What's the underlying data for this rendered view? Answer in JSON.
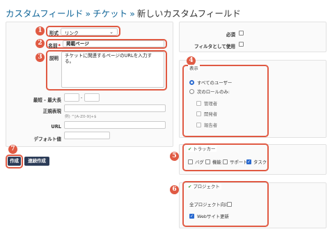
{
  "breadcrumb": {
    "custom_fields": "カスタムフィールド",
    "sep1": "»",
    "tickets": "チケット",
    "sep2": "»",
    "current": "新しいカスタムフィールド"
  },
  "badges": {
    "b1": "1",
    "b2": "2",
    "b3": "3",
    "b4": "4",
    "b5": "5",
    "b6": "6",
    "b7": "7"
  },
  "form": {
    "format_label": "形式",
    "format_value": "リンク",
    "name_label": "名前",
    "name_required": "*",
    "name_value": "掲載ページ",
    "desc_label": "説明",
    "desc_value": "チケットに関連するページのURLを入力する。",
    "minmax_label": "最短 - 最大長",
    "minmax_dash": "-",
    "regex_label": "正規表現",
    "regex_hint": "例) ^[A-Z0-9]+$",
    "url_label": "URL",
    "default_label": "デフォルト値"
  },
  "side": {
    "required_label": "必須",
    "filter_label": "フィルタとして使用",
    "visible_legend": "表示",
    "all_users": "すべてのユーザー",
    "roles_only": "次のロールのみ:",
    "role_manager": "管理者",
    "role_dev": "開発者",
    "role_reporter": "報告者",
    "tracker_legend": "トラッカー",
    "tracker_bug": "バグ",
    "tracker_feature": "機能",
    "tracker_support": "サポート",
    "tracker_task": "タスク",
    "project_legend": "プロジェクト",
    "all_projects": "全プロジェクト向け",
    "website_update": "Webサイト更新",
    "checkmark": "✔"
  },
  "buttons": {
    "create": "作成",
    "create_continue": "連続作成"
  },
  "colors": {
    "accent": "#e05a43",
    "link": "#116699",
    "button": "#2c3c58",
    "check": "#2a6ad0"
  }
}
